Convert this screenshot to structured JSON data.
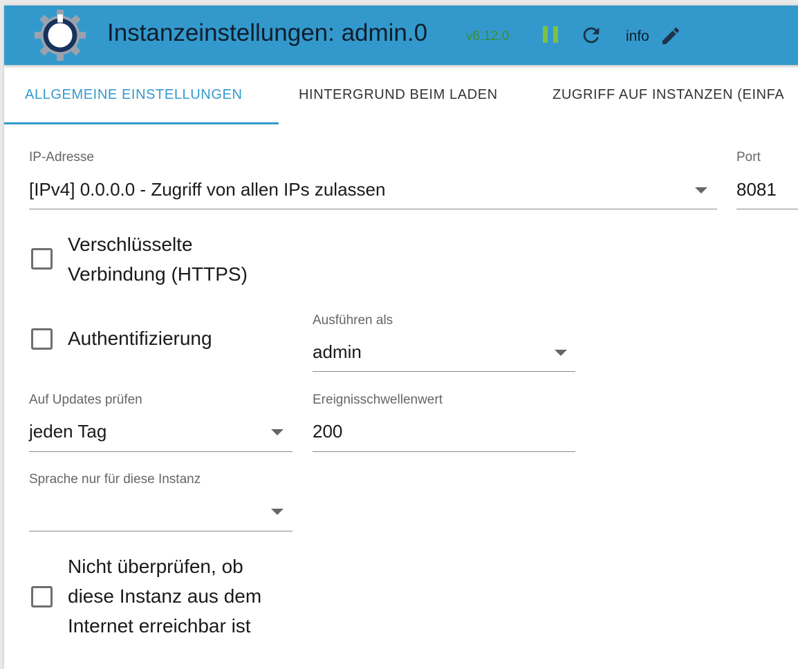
{
  "header": {
    "title": "Instanzeinstellungen: admin.0",
    "version": "v6.12.0",
    "info_label": "info",
    "colors": {
      "bar": "#3399cc",
      "version": "#3c8d2f",
      "pause": "#7cc242"
    }
  },
  "tabs": [
    {
      "label": "ALLGEMEINE EINSTELLUNGEN",
      "active": true
    },
    {
      "label": "HINTERGRUND BEIM LADEN",
      "active": false
    },
    {
      "label": "ZUGRIFF AUF INSTANZEN (EINFA",
      "active": false
    }
  ],
  "form": {
    "ip": {
      "label": "IP-Adresse",
      "value": "[IPv4] 0.0.0.0 - Zugriff von allen IPs zulassen"
    },
    "port": {
      "label": "Port",
      "value": "8081"
    },
    "https": {
      "label": "Verschlüsselte\nVerbindung (HTTPS)",
      "checked": false
    },
    "auth": {
      "label": "Authentifizierung",
      "checked": false
    },
    "run_as": {
      "label": "Ausführen als",
      "value": "admin"
    },
    "updates": {
      "label": "Auf Updates prüfen",
      "value": "jeden Tag"
    },
    "threshold": {
      "label": "Ereignisschwellenwert",
      "value": "200"
    },
    "language": {
      "label": "Sprache nur für diese Instanz",
      "value": ""
    },
    "no_check": {
      "label": "Nicht überprüfen, ob\ndiese Instanz aus dem\nInternet erreichbar ist",
      "checked": false
    }
  },
  "icons": [
    "gear-logo-icon",
    "pause-icon",
    "refresh-icon",
    "edit-icon",
    "dropdown-arrow-icon"
  ]
}
